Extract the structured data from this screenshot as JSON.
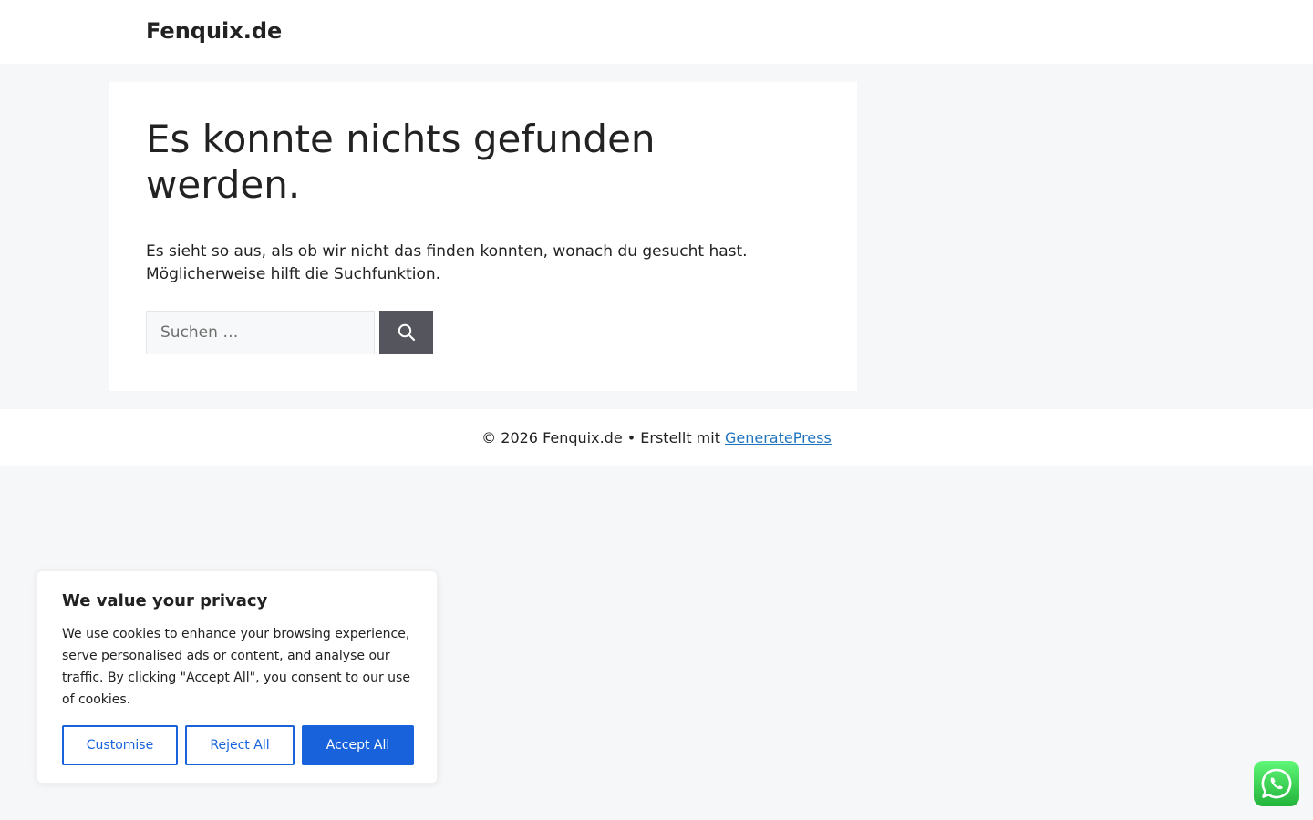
{
  "header": {
    "site_title": "Fenquix.de"
  },
  "main": {
    "title": "Es konnte nichts gefunden werden.",
    "text": "Es sieht so aus, als ob wir nicht das finden konnten, wonach du gesucht hast. Möglicherweise hilft die Suchfunktion.",
    "search": {
      "placeholder": "Suchen …",
      "value": "",
      "button_icon": "search-icon"
    }
  },
  "footer": {
    "copyright": "© 2026 Fenquix.de • Erstellt mit",
    "link_label": "GeneratePress"
  },
  "cookie_banner": {
    "title": "We value your privacy",
    "text": "We use cookies to enhance your browsing experience, serve personalised ads or content, and analyse our traffic. By clicking \"Accept All\", you consent to our use of cookies.",
    "customise_label": "Customise",
    "reject_label": "Reject All",
    "accept_label": "Accept All",
    "accent_color": "#1863dc"
  },
  "floating": {
    "whatsapp_icon": "whatsapp-icon"
  }
}
